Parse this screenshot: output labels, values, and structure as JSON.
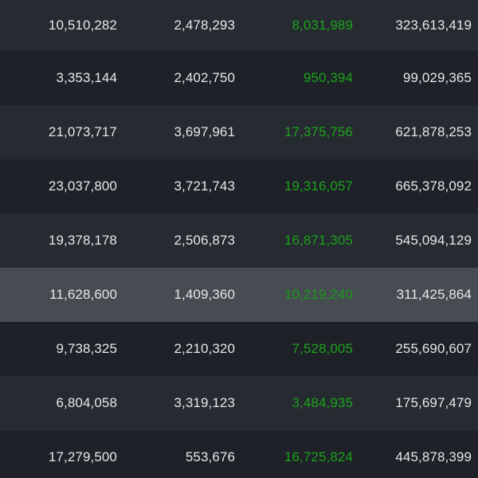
{
  "table": {
    "rows": [
      {
        "c1": "10,510,282",
        "c2": "2,478,293",
        "c3": "8,031,989",
        "c4": "323,613,419"
      },
      {
        "c1": "3,353,144",
        "c2": "2,402,750",
        "c3": "950,394",
        "c4": "99,029,365"
      },
      {
        "c1": "21,073,717",
        "c2": "3,697,961",
        "c3": "17,375,756",
        "c4": "621,878,253"
      },
      {
        "c1": "23,037,800",
        "c2": "3,721,743",
        "c3": "19,316,057",
        "c4": "665,378,092"
      },
      {
        "c1": "19,378,178",
        "c2": "2,506,873",
        "c3": "16,871,305",
        "c4": "545,094,129"
      },
      {
        "c1": "11,628,600",
        "c2": "1,409,360",
        "c3": "10,219,240",
        "c4": "311,425,864"
      },
      {
        "c1": "9,738,325",
        "c2": "2,210,320",
        "c3": "7,528,005",
        "c4": "255,690,607"
      },
      {
        "c1": "6,804,058",
        "c2": "3,319,123",
        "c3": "3,484,935",
        "c4": "175,697,479"
      },
      {
        "c1": "17,279,500",
        "c2": "553,676",
        "c3": "16,725,824",
        "c4": "445,878,399"
      }
    ],
    "highlighted_row_index": 5
  },
  "colors": {
    "background": "#1b1e24",
    "row_even": "#262a31",
    "row_odd": "#1e2128",
    "row_highlight": "#474c52",
    "text": "#e6e7ea",
    "positive": "#1ca31c"
  }
}
